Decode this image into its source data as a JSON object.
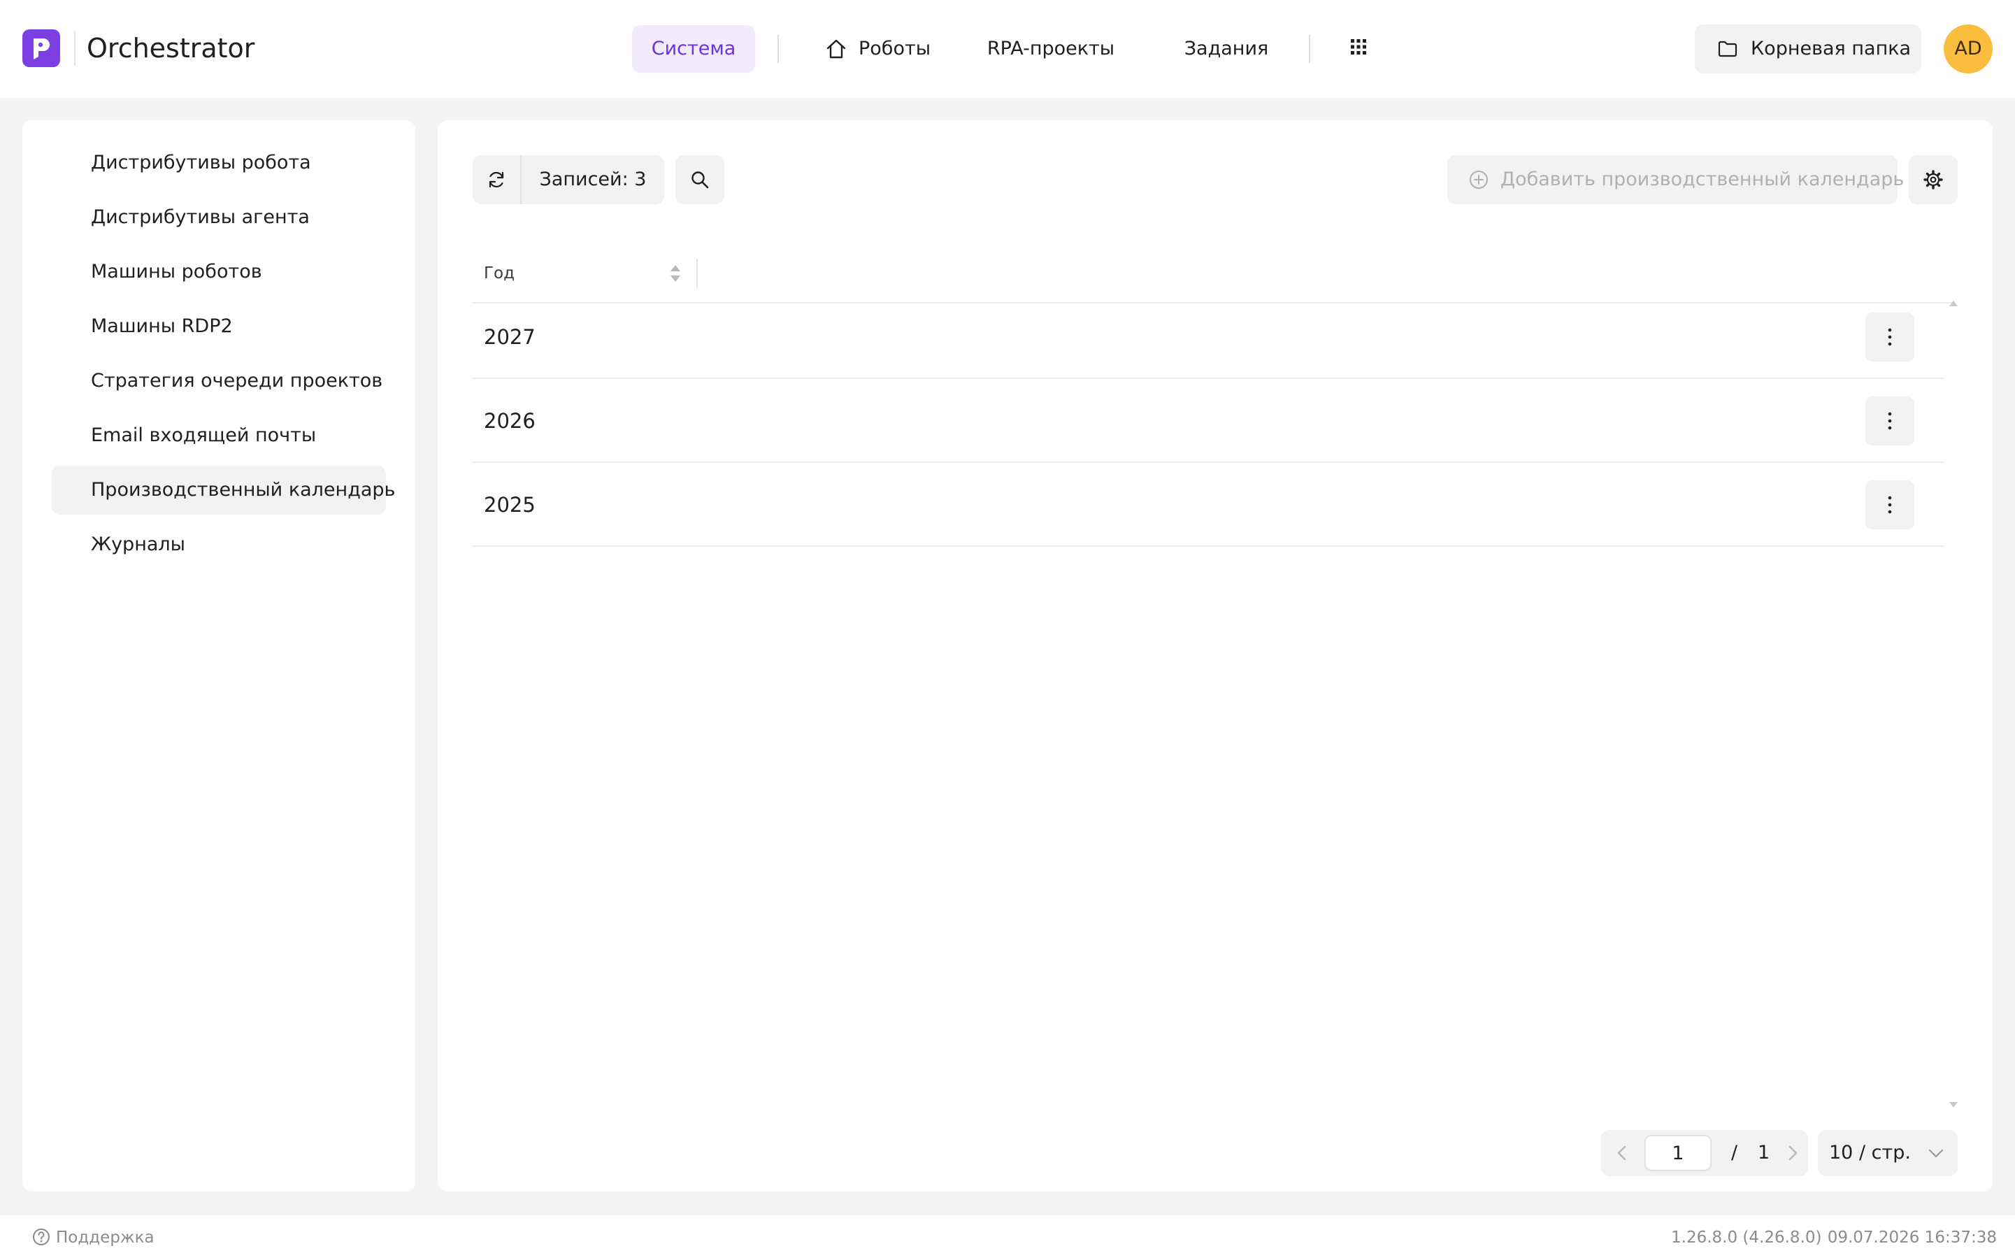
{
  "header": {
    "brand": "Orchestrator",
    "nav": [
      {
        "label": "Система",
        "active": true
      },
      {
        "label": "Роботы",
        "icon": "home-icon"
      },
      {
        "label": "RPA-проекты"
      },
      {
        "label": "Задания"
      }
    ],
    "apps_icon": "grid-icon",
    "folder_label": "Корневая папка",
    "avatar_initials": "AD",
    "colors": {
      "accent": "#7b3fe4",
      "active_bg": "#f1ebfd",
      "avatar": "#fbbd3e"
    }
  },
  "sidebar": {
    "items": [
      {
        "label": "Дистрибутивы робота"
      },
      {
        "label": "Дистрибутивы агента"
      },
      {
        "label": "Машины роботов"
      },
      {
        "label": "Машины RDP2"
      },
      {
        "label": "Стратегия очереди проектов"
      },
      {
        "label": "Email входящей почты"
      },
      {
        "label": "Производственный календарь",
        "active": true
      },
      {
        "label": "Журналы"
      }
    ]
  },
  "toolbar": {
    "records_label": "Записей: 3",
    "add_label": "Добавить производственный календарь"
  },
  "table": {
    "columns": [
      "Год"
    ],
    "rows": [
      {
        "year": "2027"
      },
      {
        "year": "2026"
      },
      {
        "year": "2025"
      }
    ]
  },
  "pagination": {
    "current_page": "1",
    "separator": "/",
    "total_pages": "1",
    "page_size": "10 / стр."
  },
  "footer": {
    "support": "Поддержка",
    "version": "1.26.8.0 (4.26.8.0)",
    "datetime": "09.07.2026 16:37:38"
  }
}
